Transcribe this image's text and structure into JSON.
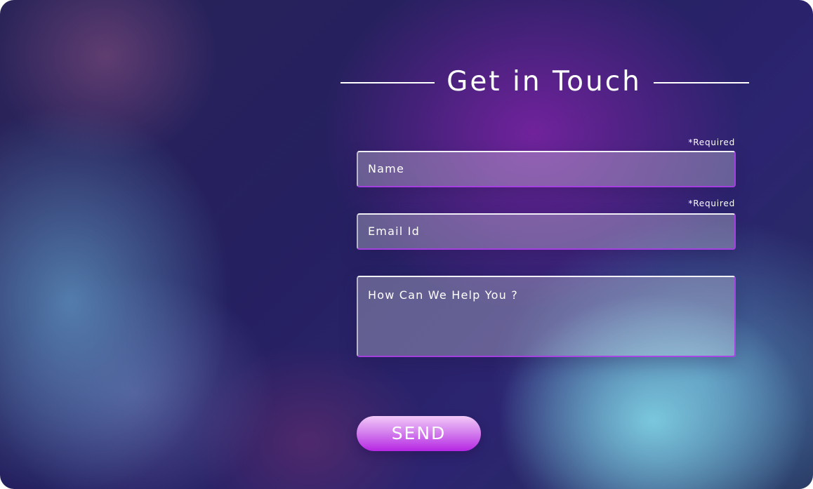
{
  "contact_form": {
    "title": "Get in Touch",
    "name_required_note": "*Required",
    "name_placeholder": "Name",
    "email_required_note": "*Required",
    "email_placeholder": "Email Id",
    "message_placeholder": "How Can We Help You ?",
    "send_label": "SEND"
  },
  "colors": {
    "accent": "#b626e3",
    "text": "#ffffff"
  }
}
